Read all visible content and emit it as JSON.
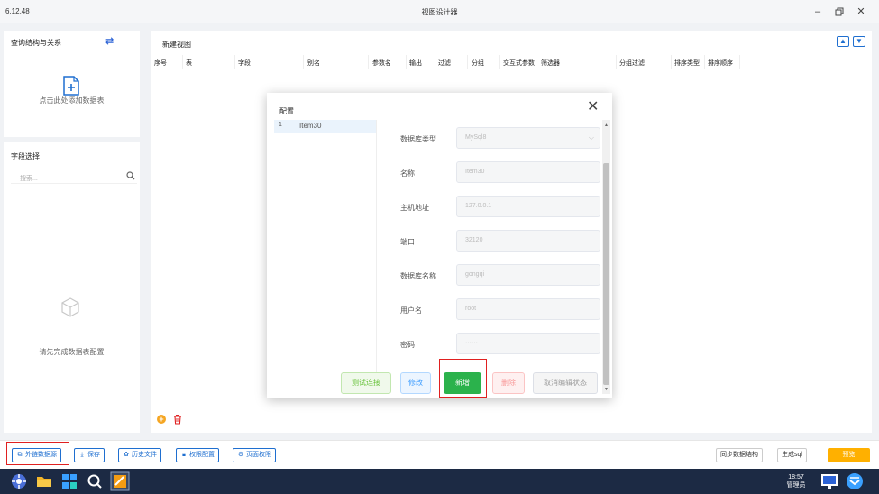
{
  "titlebar": {
    "version": "6.12.48",
    "title": "视图设计器"
  },
  "left": {
    "query_title": "查询结构与关系",
    "add_table_text": "点击此处添加数据表",
    "field_title": "字段选择",
    "search_placeholder": "搜索...",
    "empty_text": "请先完成数据表配置"
  },
  "main": {
    "view_title": "新建视图",
    "columns": [
      "序号",
      "表",
      "字段",
      "别名",
      "参数名",
      "输出",
      "过滤",
      "分组",
      "交互式参数",
      "筛选器",
      "分组过滤",
      "排序类型",
      "排序顺序"
    ]
  },
  "toolbar": {
    "external_source": "外链数据源",
    "save": "保存",
    "history": "历史文件",
    "permission": "权限配置",
    "page_permission": "页面权限",
    "sync": "同步数据结构",
    "gen_sql": "生成sql",
    "preview": "预览"
  },
  "taskbar": {
    "time": "18:57",
    "user": "管理员"
  },
  "modal": {
    "title": "配置",
    "list": [
      {
        "no": "1",
        "name": "Item30"
      }
    ],
    "fields": [
      {
        "label": "数据库类型",
        "value": "MySql8"
      },
      {
        "label": "名称",
        "value": "Item30"
      },
      {
        "label": "主机地址",
        "value": "127.0.0.1"
      },
      {
        "label": "端口",
        "value": "32120"
      },
      {
        "label": "数据库名称",
        "value": "gongqi"
      },
      {
        "label": "用户名",
        "value": "root"
      },
      {
        "label": "密码",
        "value": "······"
      }
    ],
    "buttons": {
      "test": "测试连接",
      "modify": "修改",
      "add": "新增",
      "delete": "删除",
      "cancel_edit": "取消编辑状态"
    }
  },
  "colors": {
    "accent": "#1f6fd0",
    "success": "#2bb24c",
    "warning": "#ffb000",
    "highlight_box": "#e02020",
    "taskbar": "#1c2a44"
  }
}
